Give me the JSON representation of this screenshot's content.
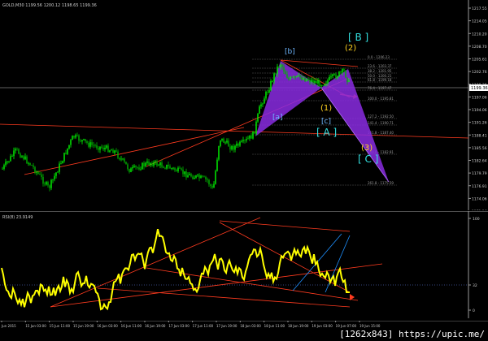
{
  "main": {
    "symbol_line": "GOLD,M30  1199.56  1200.12  1198.65  1199.36",
    "price_ticks": [
      "1217.55",
      "1214.05",
      "1210.20",
      "1208.70",
      "1205.61",
      "1202.76",
      "1199.36",
      "1197.06",
      "1194.06",
      "1191.26",
      "1188.41",
      "1185.56",
      "1182.64",
      "1179.79",
      "1176.91",
      "1174.06",
      "1171.16"
    ],
    "current_price": "1199.36",
    "fib_labels": [
      "0.0 - 1206.23",
      "23.6 - 1203.37",
      "38.2 - 1201.95",
      "50.0 - 1200.21",
      "61.8 - 1199.18",
      "76.4 - 1197.47",
      "100.0 - 1195.81",
      "127.2 - 1192.50",
      "141.4 - 1190.71",
      "161.8 - 1187.40",
      "200.0 - 1182.91",
      "261.8 - 1175.59"
    ],
    "wave_labels": {
      "B_big": "[ B ]",
      "two": "(2)",
      "b_small": "[b]",
      "a_small": "[a]",
      "one": "(1)",
      "c_small": "[c]",
      "A_big": "[ A ]",
      "three": "(3)",
      "C_big": "[ C ]"
    }
  },
  "rsi": {
    "title": "RSI(8) 23.9149",
    "ticks": [
      "100",
      "32",
      "0"
    ]
  },
  "time_labels": [
    "Jun 2015",
    "15 Jun 03:00",
    "15 Jun 11:00",
    "15 Jun 19:00",
    "16 Jun 03:00",
    "16 Jun 11:00",
    "16 Jun 19:00",
    "17 Jun 03:00",
    "17 Jun 11:00",
    "17 Jun 19:00",
    "18 Jun 03:00",
    "18 Jun 11:00",
    "18 Jun 19:00",
    "19 Jun 03:00",
    "19 Jun 07:00",
    "19 Jun 15:00"
  ],
  "footer": {
    "watermark": "[1262x843] https://upic.me/"
  },
  "colors": {
    "bull": "#00ff00",
    "bear": "#00b400",
    "rsi_line": "#ffff00",
    "trend": "#ff3b1f",
    "channel": "#1e90ff",
    "pattern": "#8a2be2",
    "wave_blue": "#6fb7ff",
    "wave_cyan": "#33e0e0",
    "wave_yellow": "#ffd21f"
  }
}
